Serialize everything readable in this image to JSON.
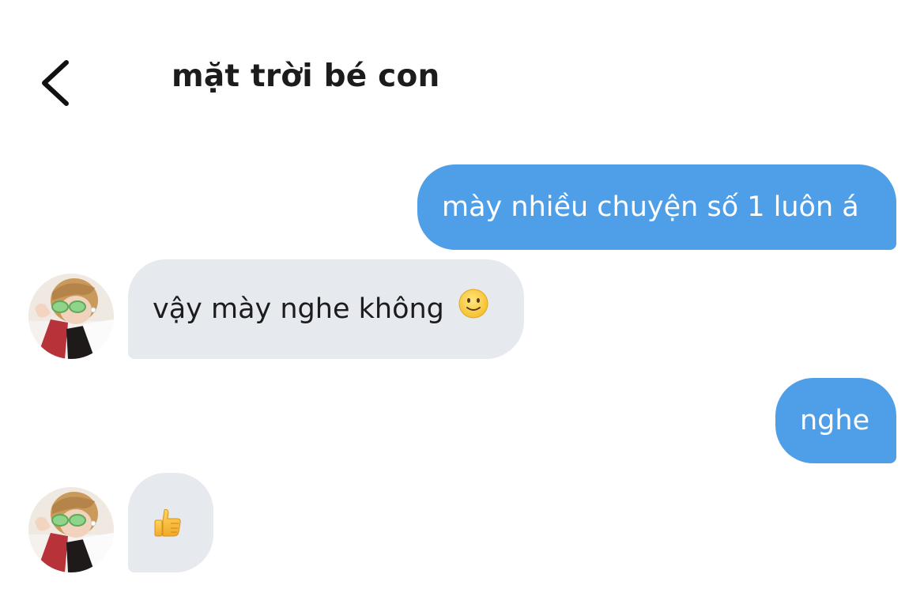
{
  "header": {
    "title": "mặt trời bé con",
    "back_icon": "chevron-left-icon"
  },
  "messages": [
    {
      "direction": "sent",
      "text": "mày nhiều chuyện số 1 luôn á"
    },
    {
      "direction": "received",
      "text": "vậy mày nghe không",
      "emoji": "slightly-smiling-face-icon"
    },
    {
      "direction": "sent",
      "text": "nghe"
    },
    {
      "direction": "received",
      "emoji": "thumbs-up-icon"
    }
  ],
  "colors": {
    "sent_bubble": "#4f9fe8",
    "received_bubble": "#e6eaef",
    "title_text": "#1c1c1e"
  }
}
